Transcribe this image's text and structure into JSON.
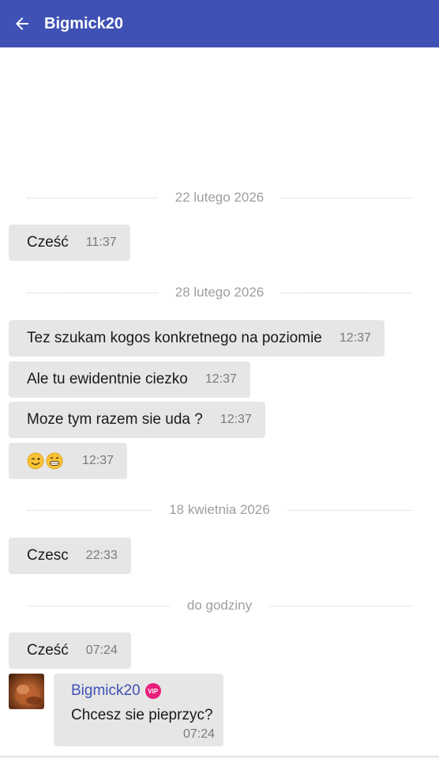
{
  "header": {
    "title": "Bigmick20",
    "back_icon": "arrow-left-icon",
    "background": "#3f51b5"
  },
  "chat": {
    "date_separators": [
      {
        "label": "22 lutego 2026"
      },
      {
        "label": "28 lutego 2026"
      },
      {
        "label": "18 kwietnia 2026"
      },
      {
        "label": "do godziny"
      }
    ],
    "messages": [
      {
        "text": "Cześć",
        "time": "11:37"
      },
      {
        "text": "Tez szukam kogos konkretnego na poziomie",
        "time": "12:37"
      },
      {
        "text": "Ale tu ewidentnie ciezko",
        "time": "12:37"
      },
      {
        "text": "Moze tym razem sie uda ?",
        "time": "12:37"
      },
      {
        "text": "",
        "emoji": [
          "winking-face-emoji",
          "grinning-face-emoji"
        ],
        "time": "12:37"
      },
      {
        "text": "Czesc",
        "time": "22:33"
      },
      {
        "text": "Cześć",
        "time": "07:24"
      }
    ],
    "incoming": {
      "sender": "Bigmick20",
      "badge": "VIP",
      "text": "Chcesz sie pieprzyc?",
      "time": "07:24"
    }
  },
  "colors": {
    "accent": "#3f51b5",
    "bubble": "#e6e6e6",
    "vip_badge": "#e91e7a"
  }
}
